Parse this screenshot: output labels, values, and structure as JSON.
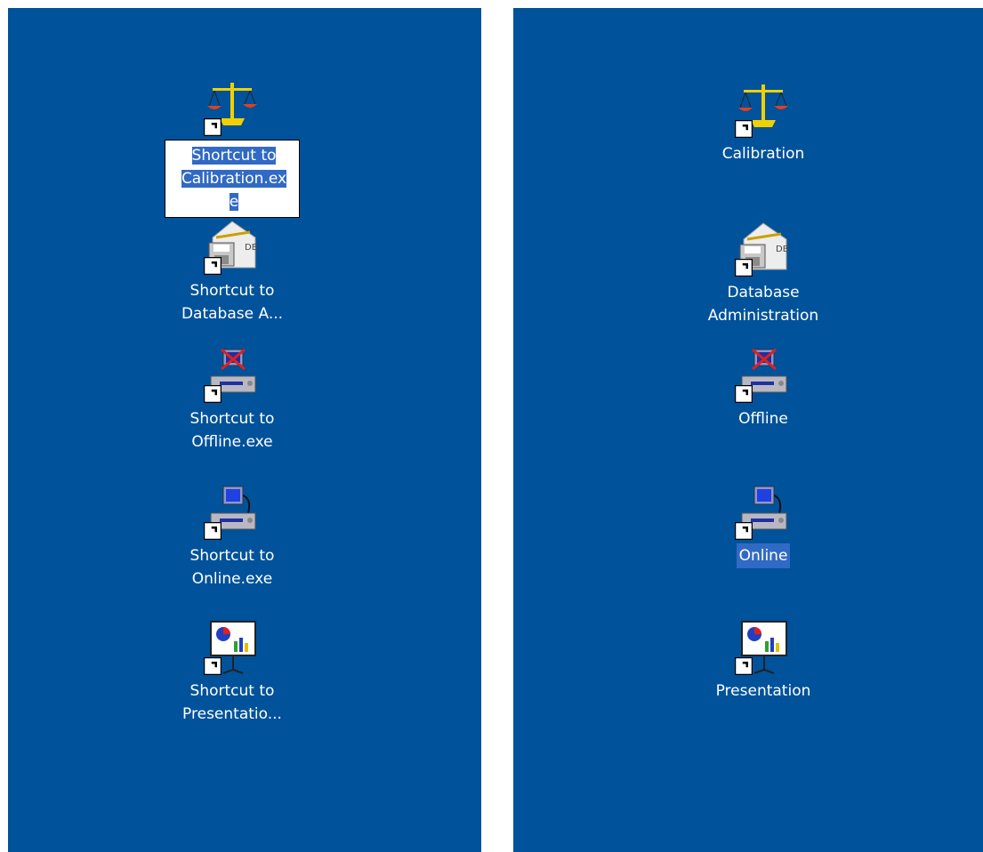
{
  "desktop": {
    "background": "#00529b"
  },
  "left_panel": {
    "icons": [
      {
        "id": "calibration",
        "icon": "scale-icon",
        "label": "Shortcut to\nCalibration.ex\ne",
        "state": "renaming"
      },
      {
        "id": "database",
        "icon": "database-admin-icon",
        "label": "Shortcut to\nDatabase A..."
      },
      {
        "id": "offline",
        "icon": "offline-computer-icon",
        "label": "Shortcut to\nOffline.exe"
      },
      {
        "id": "online",
        "icon": "online-computer-icon",
        "label": "Shortcut to\nOnline.exe"
      },
      {
        "id": "presentation",
        "icon": "presentation-board-icon",
        "label": "Shortcut to\nPresentatio..."
      }
    ]
  },
  "right_panel": {
    "icons": [
      {
        "id": "calibration",
        "icon": "scale-icon",
        "label": "Calibration"
      },
      {
        "id": "database",
        "icon": "database-admin-icon",
        "label": "Database\nAdministration"
      },
      {
        "id": "offline",
        "icon": "offline-computer-icon",
        "label": "Offline"
      },
      {
        "id": "online",
        "icon": "online-computer-icon",
        "label": "Online",
        "state": "selected"
      },
      {
        "id": "presentation",
        "icon": "presentation-board-icon",
        "label": "Presentation"
      }
    ]
  },
  "colors": {
    "selection": "#316ac5",
    "label_text": "#ffffff"
  }
}
